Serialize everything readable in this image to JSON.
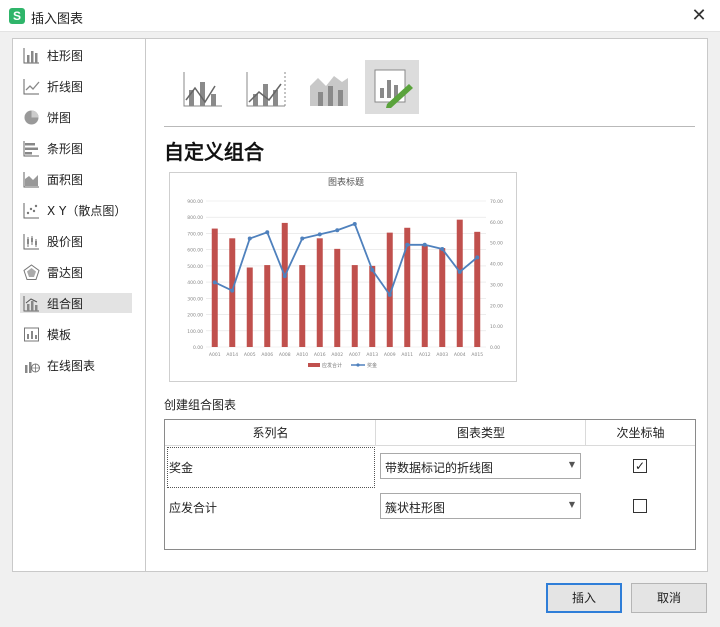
{
  "window": {
    "title": "插入图表",
    "app_icon": "S"
  },
  "sidebar": {
    "items": [
      {
        "label": "柱形图",
        "icon": "column-chart-icon"
      },
      {
        "label": "折线图",
        "icon": "line-chart-icon"
      },
      {
        "label": "饼图",
        "icon": "pie-chart-icon"
      },
      {
        "label": "条形图",
        "icon": "bar-chart-icon"
      },
      {
        "label": "面积图",
        "icon": "area-chart-icon"
      },
      {
        "label": "X Y（散点图）",
        "icon": "scatter-chart-icon"
      },
      {
        "label": "股价图",
        "icon": "stock-chart-icon"
      },
      {
        "label": "雷达图",
        "icon": "radar-chart-icon"
      },
      {
        "label": "组合图",
        "icon": "combo-chart-icon",
        "selected": true
      },
      {
        "label": "模板",
        "icon": "template-icon"
      },
      {
        "label": "在线图表",
        "icon": "online-chart-icon"
      }
    ]
  },
  "main": {
    "combo_types": [
      "clustered-column-line-icon",
      "clustered-column-line-secondary-icon",
      "stacked-area-column-icon",
      "custom-combo-icon"
    ],
    "selected_type_index": 3,
    "section_title": "自定义组合"
  },
  "chart_data": {
    "type": "bar",
    "title": "图表标题",
    "categories": [
      "A001",
      "A014",
      "A005",
      "A006",
      "A008",
      "A010",
      "A016",
      "A002",
      "A007",
      "A013",
      "A009",
      "A011",
      "A012",
      "A003",
      "A004",
      "A015"
    ],
    "series": [
      {
        "name": "应发合计",
        "kind": "bar",
        "axis": "primary",
        "color": "#c0504d",
        "values": [
          730,
          670,
          490,
          505,
          765,
          505,
          670,
          605,
          505,
          500,
          705,
          735,
          625,
          610,
          785,
          710
        ]
      },
      {
        "name": "奖金",
        "kind": "line-markers",
        "axis": "secondary",
        "color": "#4f81bd",
        "values": [
          31,
          27,
          52,
          55,
          34,
          52,
          54,
          56,
          59,
          37,
          25,
          49,
          49,
          47,
          36,
          43
        ]
      }
    ],
    "primary_axis": {
      "ylim": [
        0,
        900
      ],
      "ticks": [
        "0.00",
        "100.00",
        "200.00",
        "300.00",
        "400.00",
        "500.00",
        "600.00",
        "700.00",
        "800.00",
        "900.00"
      ]
    },
    "secondary_axis": {
      "ylim": [
        0,
        70
      ],
      "ticks": [
        "0.00",
        "10.00",
        "20.00",
        "30.00",
        "40.00",
        "50.00",
        "60.00",
        "70.00"
      ]
    },
    "grid": true,
    "legend_position": "bottom"
  },
  "combo_section": {
    "label": "创建组合图表",
    "headers": {
      "series_name": "系列名",
      "chart_type": "图表类型",
      "secondary_axis": "次坐标轴"
    },
    "rows": [
      {
        "name": "奖金",
        "chart_type": "带数据标记的折线图",
        "secondary": true,
        "check": "✓"
      },
      {
        "name": "应发合计",
        "chart_type": "簇状柱形图",
        "secondary": false,
        "check": ""
      }
    ]
  },
  "buttons": {
    "insert": "插入",
    "cancel": "取消"
  },
  "colors": {
    "accent": "#2f7ed8",
    "bar": "#c0504d",
    "line": "#4f81bd",
    "check_green": "#5aa33c"
  }
}
